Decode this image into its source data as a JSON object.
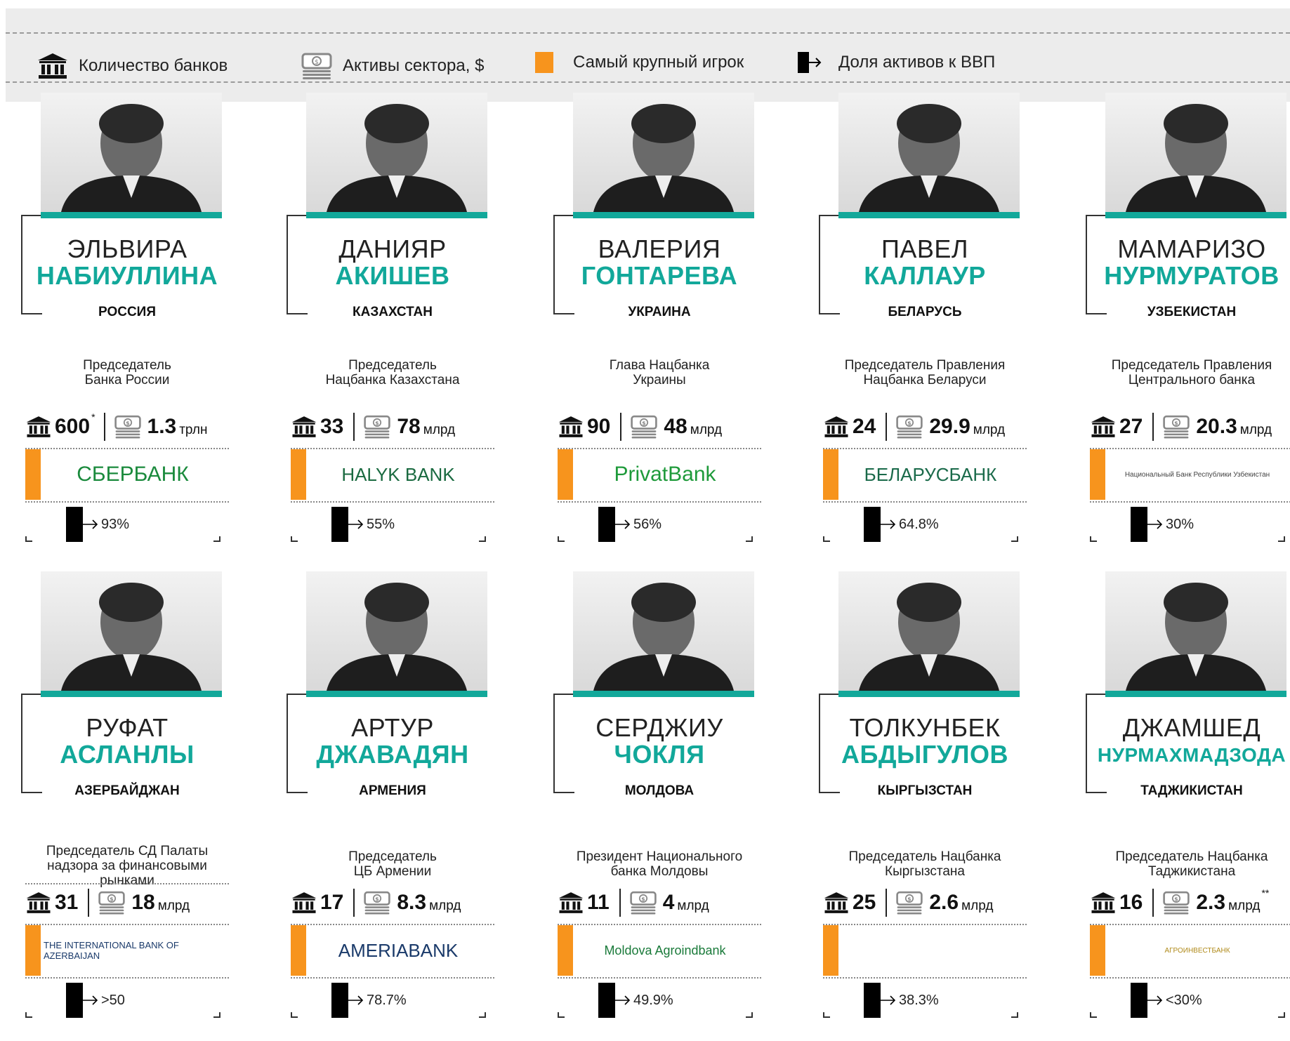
{
  "legend": {
    "banks_label": "Количество банков",
    "assets_label": "Активы сектора, $",
    "top_player_label": "Самый крупный игрок",
    "gdp_label": "Доля активов к ВВП",
    "accent_color": "#12a89a",
    "orange_color": "#f7941d"
  },
  "people": [
    {
      "first": "ЭЛЬВИРА",
      "last": "НАБИУЛЛИНА",
      "country": "РОССИЯ",
      "pos1": "Председатель",
      "pos2": "Банка России",
      "pos3": "",
      "banks": "600",
      "banks_note": "*",
      "assets": "1.3",
      "unit": "трлн",
      "assets_note": "",
      "logo": "СБЕРБАНК",
      "gdp": "93%"
    },
    {
      "first": "ДАНИЯР",
      "last": "АКИШЕВ",
      "country": "КАЗАХСТАН",
      "pos1": "Председатель",
      "pos2": "Нацбанка Казахстана",
      "pos3": "",
      "banks": "33",
      "banks_note": "",
      "assets": "78",
      "unit": "млрд",
      "assets_note": "",
      "logo": "HALYK BANK",
      "gdp": "55%"
    },
    {
      "first": "ВАЛЕРИЯ",
      "last": "ГОНТАРЕВА",
      "country": "УКРАИНА",
      "pos1": "Глава Нацбанка",
      "pos2": "Украины",
      "pos3": "",
      "banks": "90",
      "banks_note": "",
      "assets": "48",
      "unit": "млрд",
      "assets_note": "",
      "logo": "PrivatBank",
      "gdp": "56%"
    },
    {
      "first": "ПАВЕЛ",
      "last": "КАЛЛАУР",
      "country": "БЕЛАРУСЬ",
      "pos1": "Председатель Правления",
      "pos2": "Нацбанка Беларуси",
      "pos3": "",
      "banks": "24",
      "banks_note": "",
      "assets": "29.9",
      "unit": "млрд",
      "assets_note": "",
      "logo": "БЕЛАРУСБАНК",
      "gdp": "64.8%"
    },
    {
      "first": "МАМАРИЗО",
      "last": "НУРМУРАТОВ",
      "country": "УЗБЕКИСТАН",
      "pos1": "Председатель Правления",
      "pos2": "Центрального банка",
      "pos3": "",
      "banks": "27",
      "banks_note": "",
      "assets": "20.3",
      "unit": "млрд",
      "assets_note": "",
      "logo": "Национальный Банк Республики Узбекистан",
      "gdp": "30%"
    },
    {
      "first": "РУФАТ",
      "last": "АСЛАНЛЫ",
      "country": "АЗЕРБАЙДЖАН",
      "pos1": "Председатель СД Палаты",
      "pos2": "надзора за финансовыми",
      "pos3": "рынками",
      "banks": "31",
      "banks_note": "",
      "assets": "18",
      "unit": "млрд",
      "assets_note": "",
      "logo": "THE INTERNATIONAL BANK OF AZERBAIJAN",
      "gdp": ">50"
    },
    {
      "first": "АРТУР",
      "last": "ДЖАВАДЯН",
      "country": "АРМЕНИЯ",
      "pos1": "Председатель",
      "pos2": "ЦБ Армении",
      "pos3": "",
      "banks": "17",
      "banks_note": "",
      "assets": "8.3",
      "unit": "млрд",
      "assets_note": "",
      "logo": "AMERIABANK",
      "gdp": "78.7%"
    },
    {
      "first": "СЕРДЖИУ",
      "last": "ЧОКЛЯ",
      "country": "МОЛДОВА",
      "pos1": "Президент Национального",
      "pos2": "банка Молдовы",
      "pos3": "",
      "banks": "11",
      "banks_note": "",
      "assets": "4",
      "unit": "млрд",
      "assets_note": "",
      "logo": "Moldova Agroindbank",
      "gdp": "49.9%"
    },
    {
      "first": "ТОЛКУНБЕК",
      "last": "АБДЫГУЛОВ",
      "country": "КЫРГЫЗСТАН",
      "pos1": "Председатель Нацбанка",
      "pos2": "Кыргызстана",
      "pos3": "",
      "banks": "25",
      "banks_note": "",
      "assets": "2.6",
      "unit": "млрд",
      "assets_note": "",
      "logo": "",
      "gdp": "38.3%"
    },
    {
      "first": "ДЖАМШЕД",
      "last": "НУРМАХМАДЗОДА",
      "country": "ТАДЖИКИСТАН",
      "pos1": "Председатель Нацбанка",
      "pos2": "Таджикистана",
      "pos3": "",
      "banks": "16",
      "banks_note": "",
      "assets": "2.3",
      "unit": "млрд",
      "assets_note": "**",
      "logo": "АГРОИНВЕСТБАНК",
      "gdp": "<30%"
    }
  ]
}
